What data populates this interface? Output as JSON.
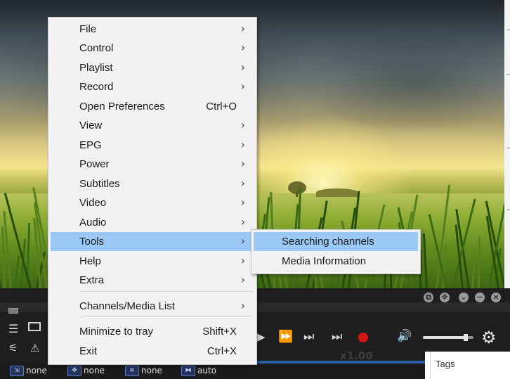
{
  "menu": {
    "items": [
      {
        "label": "File",
        "shortcut": "",
        "submenu": true
      },
      {
        "label": "Control",
        "shortcut": "",
        "submenu": true
      },
      {
        "label": "Playlist",
        "shortcut": "",
        "submenu": true
      },
      {
        "label": "Record",
        "shortcut": "",
        "submenu": true
      },
      {
        "label": "Open Preferences",
        "shortcut": "Ctrl+O",
        "submenu": false
      },
      {
        "label": "View",
        "shortcut": "",
        "submenu": true
      },
      {
        "label": "EPG",
        "shortcut": "",
        "submenu": true
      },
      {
        "label": "Power",
        "shortcut": "",
        "submenu": true
      },
      {
        "label": "Subtitles",
        "shortcut": "",
        "submenu": true
      },
      {
        "label": "Video",
        "shortcut": "",
        "submenu": true
      },
      {
        "label": "Audio",
        "shortcut": "",
        "submenu": true
      },
      {
        "label": "Tools",
        "shortcut": "",
        "submenu": true,
        "highlighted": true
      },
      {
        "label": "Help",
        "shortcut": "",
        "submenu": true
      },
      {
        "label": "Extra",
        "shortcut": "",
        "submenu": true
      },
      {
        "label": "Channels/Media List",
        "shortcut": "",
        "submenu": true
      },
      {
        "label": "Minimize to tray",
        "shortcut": "Shift+X",
        "submenu": false
      },
      {
        "label": "Exit",
        "shortcut": "Ctrl+X",
        "submenu": false
      }
    ],
    "arrow_glyph": "›"
  },
  "submenu": {
    "items": [
      {
        "label": "Searching channels",
        "highlighted": true
      },
      {
        "label": "Media Information",
        "highlighted": false
      }
    ]
  },
  "player": {
    "playback_rate": "x1.00",
    "volume_level": 0.85,
    "icons": [
      "playlist-icon",
      "window-icon",
      "equalizer-icon",
      "alert-icon",
      "play-icon",
      "fast-forward-icon",
      "next-frame-icon",
      "skip-next-icon",
      "record-icon",
      "volume-icon",
      "settings-icon",
      "snapshot-icon",
      "fullscreen-icon",
      "dropdown-icon",
      "minimize-icon",
      "close-icon"
    ]
  },
  "status_bar": {
    "items": [
      {
        "icon": "aspect-icon",
        "label": "none"
      },
      {
        "icon": "crop-icon",
        "label": "none"
      },
      {
        "icon": "deinterlace-icon",
        "label": "none"
      },
      {
        "icon": "zoom-icon",
        "label": "auto"
      }
    ]
  },
  "side_panel": {
    "tags_label": "Tags"
  },
  "colors": {
    "menu_bg": "#f2f2f2",
    "highlight": "#99c9f4",
    "record": "#d01818",
    "status_accent": "#2a5fa8"
  }
}
